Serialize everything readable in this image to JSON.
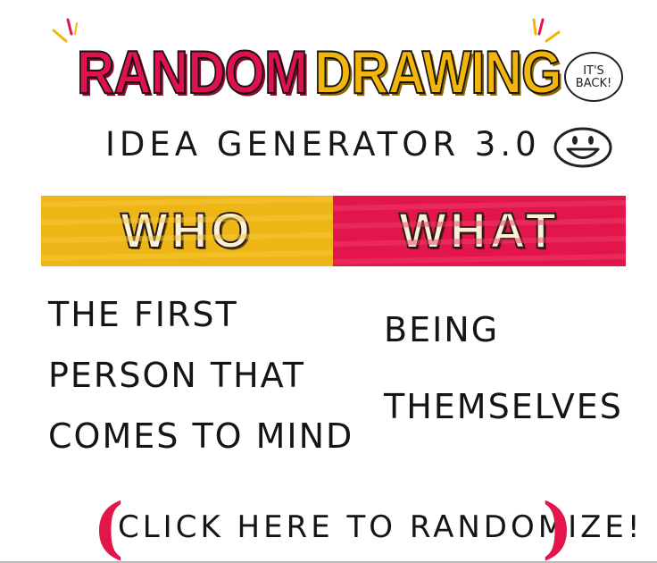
{
  "header": {
    "title_word_1": "RANDOM",
    "title_word_2": "DRAWING",
    "subtitle": "IDEA GENERATOR 3.0",
    "bubble_text": "IT'S BACK!",
    "smiley_icon": "grinning-face-icon"
  },
  "categories": {
    "who": {
      "label": "WHO",
      "color": "#eeb516"
    },
    "what": {
      "label": "WHAT",
      "color": "#e3164b"
    }
  },
  "results": {
    "who": [
      "THE FIRST",
      "PERSON THAT",
      "COMES TO MIND"
    ],
    "what": [
      "BEING",
      "THEMSELVES"
    ]
  },
  "action": {
    "randomize_label": "CLICK HERE TO RANDOMIZE!",
    "accent_color": "#e3164b"
  }
}
